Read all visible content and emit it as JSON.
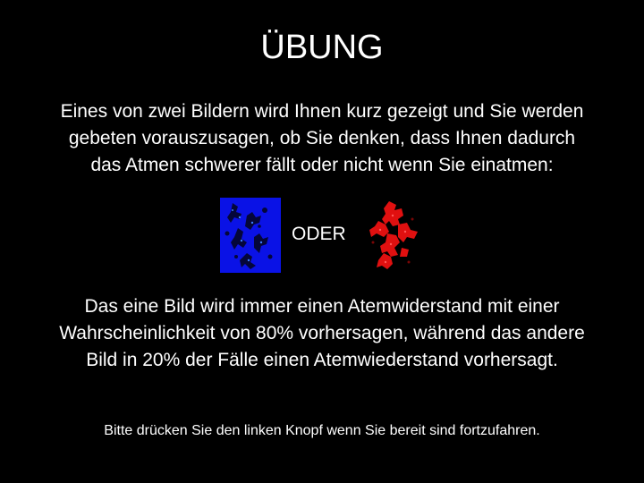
{
  "title": "ÜBUNG",
  "intro": {
    "lines": [
      "Eines von zwei Bildern wird Ihnen kurz gezeigt und Sie werden",
      "gebeten vorauszusagen, ob Sie denken, dass Ihnen dadurch",
      "das Atmen schwerer fällt oder nicht wenn Sie einatmen:"
    ]
  },
  "choices": {
    "left_image": {
      "icon": "blue-fractal-image",
      "color": "#0a10e0"
    },
    "separator": "ODER",
    "right_image": {
      "icon": "red-fractal-image",
      "color": "#e01010"
    }
  },
  "explanation": {
    "lines": [
      "Das eine Bild wird immer einen Atemwiderstand mit einer",
      "Wahrscheinlichkeit von 80% vorhersagen, während das andere",
      "Bild in 20% der Fälle einen Atemwiederstand vorhersagt."
    ]
  },
  "instruction": "Bitte drücken Sie den linken Knopf wenn Sie bereit sind fortzufahren.",
  "colors": {
    "background": "#000000",
    "text": "#ffffff"
  }
}
